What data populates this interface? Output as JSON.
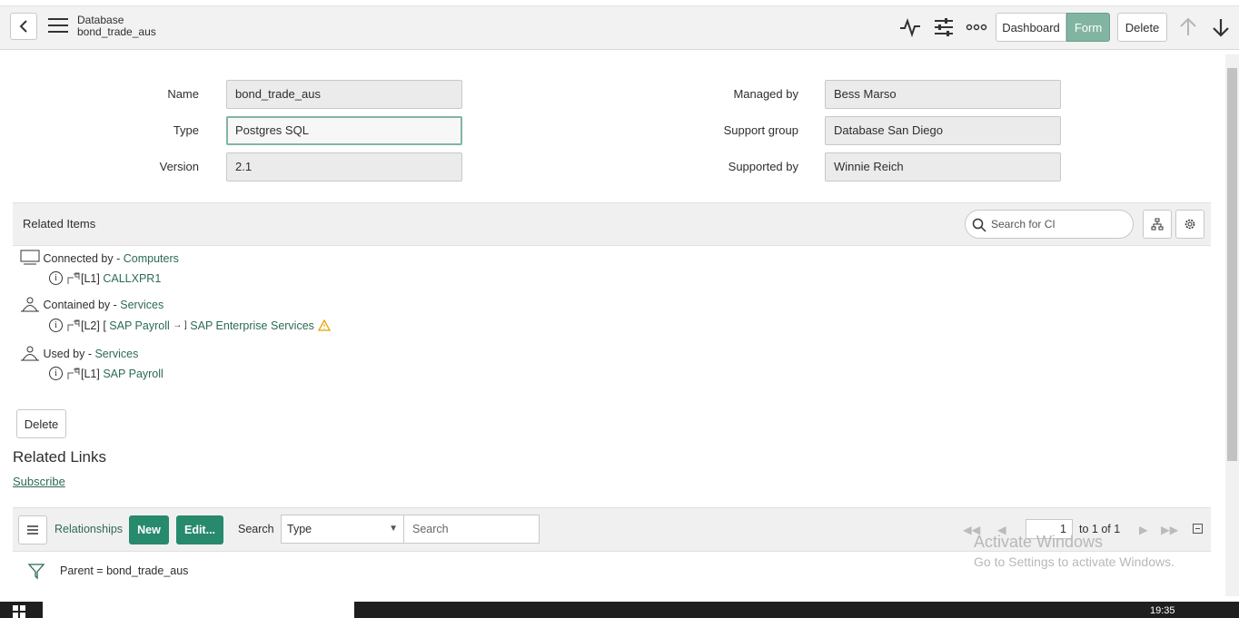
{
  "header": {
    "record_type": "Database",
    "record_name": "bond_trade_aus",
    "buttons": {
      "dashboard": "Dashboard",
      "form": "Form",
      "delete": "Delete"
    }
  },
  "form": {
    "left": [
      {
        "label": "Name",
        "value": "bond_trade_aus"
      },
      {
        "label": "Type",
        "value": "Postgres SQL"
      },
      {
        "label": "Version",
        "value": "2.1"
      }
    ],
    "right": [
      {
        "label": "Managed by",
        "value": "Bess Marso"
      },
      {
        "label": "Support group",
        "value": "Database San Diego"
      },
      {
        "label": "Supported by",
        "value": "Winnie Reich"
      }
    ]
  },
  "related_items": {
    "title": "Related Items",
    "search_placeholder": "Search for CI",
    "groups": [
      {
        "label": "Connected by - ",
        "link": "Computers",
        "items": [
          {
            "level": "[L1]",
            "name": "CALLXPR1"
          }
        ]
      },
      {
        "label": "Contained by - ",
        "link": "Services",
        "items": [
          {
            "level": "[L2] [",
            "name": "SAP Payroll",
            "arrow": "→ ]",
            "name2": "SAP Enterprise Services"
          }
        ]
      },
      {
        "label": "Used by - ",
        "link": "Services",
        "items": [
          {
            "level": "[L1]",
            "name": "SAP Payroll"
          }
        ]
      }
    ]
  },
  "delete_button": "Delete",
  "related_links": {
    "title": "Related Links",
    "subscribe": "Subscribe"
  },
  "relationships": {
    "title": "Relationships",
    "new": "New",
    "edit": "Edit...",
    "search_label": "Search",
    "type_select": "Type",
    "search_placeholder": "Search",
    "page": "1",
    "page_of": "to 1 of 1",
    "filter": "Parent = bond_trade_aus"
  },
  "watermark": {
    "line1": "Activate Windows",
    "line2": "Go to Settings to activate Windows."
  },
  "taskbar": {
    "time": "19:35"
  },
  "colors": {
    "accent": "#81b5a1",
    "link": "#2d6a55",
    "button_green": "#278a6d"
  }
}
